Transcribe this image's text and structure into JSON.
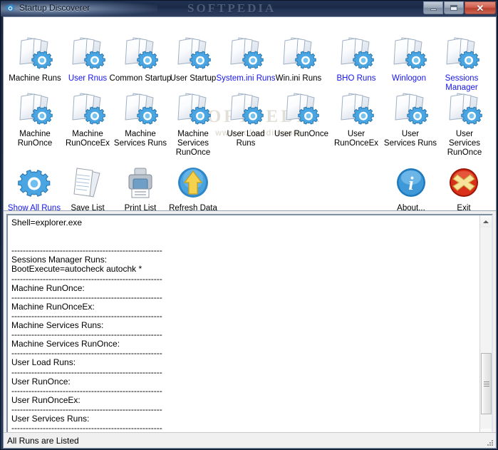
{
  "window": {
    "title": "Startup Discoverer",
    "app_icon": "gear-icon",
    "watermark_title": "SOFTPEDIA",
    "buttons": {
      "minimize": "minimize-icon",
      "maximize": "maximize-icon",
      "close": "✕"
    }
  },
  "watermark": {
    "line1": "SOFTPEDIA",
    "line2": "www.softpedia.com"
  },
  "icon_rows": {
    "row1": [
      {
        "label": "Machine Runs",
        "icon": "papers-gear-icon",
        "link": false
      },
      {
        "label": "User Rnus",
        "icon": "papers-gear-icon",
        "link": true
      },
      {
        "label": "Common Startup",
        "icon": "papers-gear-icon",
        "link": false
      },
      {
        "label": "User Startup",
        "icon": "papers-gear-icon",
        "link": false
      },
      {
        "label": "System.ini Runs",
        "icon": "papers-gear-icon",
        "link": true
      },
      {
        "label": "Win.ini Runs",
        "icon": "papers-gear-icon",
        "link": false
      },
      {
        "label": "BHO Runs",
        "icon": "papers-gear-icon",
        "link": true
      },
      {
        "label": "Winlogon",
        "icon": "papers-gear-icon",
        "link": true
      },
      {
        "label": "Sessions Manager",
        "icon": "papers-gear-icon",
        "link": true
      }
    ],
    "row2": [
      {
        "label": "Machine\nRunOnce",
        "icon": "papers-gear-icon",
        "link": false
      },
      {
        "label": "Machine\nRunOnceEx",
        "icon": "papers-gear-icon",
        "link": false
      },
      {
        "label": "Machine\nServices Runs",
        "icon": "papers-gear-icon",
        "link": false
      },
      {
        "label": "Machine\nServices\nRunOnce",
        "icon": "papers-gear-icon",
        "link": false
      },
      {
        "label": "User Load\nRuns",
        "icon": "papers-gear-icon",
        "link": false
      },
      {
        "label": "User RunOnce",
        "icon": "papers-gear-icon",
        "link": false
      },
      {
        "label": "User\nRunOnceEx",
        "icon": "papers-gear-icon",
        "link": false
      },
      {
        "label": "User\nServices Runs",
        "icon": "papers-gear-icon",
        "link": false
      },
      {
        "label": "User\nServices\nRunOnce",
        "icon": "papers-gear-icon",
        "link": false
      }
    ],
    "row3": [
      {
        "label": "Show All Runs",
        "icon": "gear-icon",
        "link": true
      },
      {
        "label": "Save List",
        "icon": "document-save-icon",
        "link": false
      },
      {
        "label": "Print List",
        "icon": "printer-icon",
        "link": false
      },
      {
        "label": "Refresh Data",
        "icon": "refresh-up-arrow-icon",
        "link": false
      },
      {
        "label": "About...",
        "icon": "info-icon",
        "link": false
      },
      {
        "label": "Exit",
        "icon": "exit-cross-icon",
        "link": false
      }
    ]
  },
  "output": {
    "text": "Shell=explorer.exe\n\n\n-----------------------------------------------------\nSessions Manager Runs:\nBootExecute=autocheck autochk *\n-----------------------------------------------------\nMachine RunOnce:\n-----------------------------------------------------\nMachine RunOnceEx:\n-----------------------------------------------------\nMachine Services Runs:\n-----------------------------------------------------\nMachine Services RunOnce:\n-----------------------------------------------------\nUser Load Runs:\n-----------------------------------------------------\nUser RunOnce:\n-----------------------------------------------------\nUser RunOnceEx:\n-----------------------------------------------------\nUser Services Runs:\n-----------------------------------------------------\nUser Services RunOnce:\n-----------------------------------------------------"
  },
  "scrollbar": {
    "up_arrow": "arrow-up-icon",
    "down_arrow": "arrow-down-icon",
    "thumb_position_percent": 68
  },
  "statusbar": {
    "message": "All Runs are Listed"
  },
  "colors": {
    "link": "#1515ee",
    "text": "#000000",
    "panel_bg": "#ffffff",
    "client_bg": "#f0f0f0",
    "title_gradient_start": "#16233d",
    "title_gradient_end": "#2b3c5c",
    "close_button": "#c0392b",
    "gear_blue": "#3f9fe0",
    "exit_red": "#d42a1a",
    "info_blue": "#2f8fd8"
  }
}
